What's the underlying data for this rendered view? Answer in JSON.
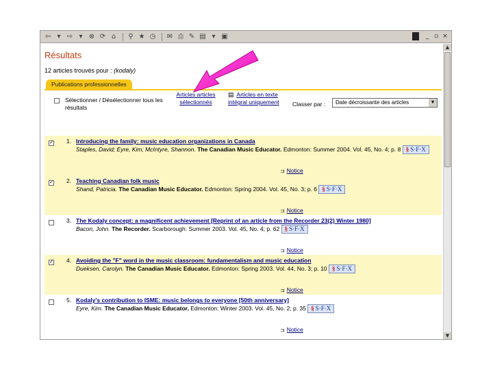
{
  "page": {
    "title": "Résultats",
    "count_text": "12 articles trouvés pour :",
    "query": "(kodaly)",
    "tab_label": "Publications professionnelles"
  },
  "controls": {
    "select_all": "Sélectionner / Désélectionner tous les résultats",
    "selected_articles": "Articles articles sélectionnés",
    "fulltext": "Articles en texte intégral uniquement",
    "sort_label": "Classer par :",
    "sort_value": "Date décroissante des articles"
  },
  "results": [
    {
      "checked": true,
      "num": "1.",
      "title": "Introducing the family: music education organizations in Canada",
      "authors": "Staples, David; Eyre, Kim; McIntyre, Shannon.",
      "journal": "The Canadian Music Educator.",
      "details": "Edmonton: Summer 2004. Vol. 45, No. 4; p. 8",
      "notice": "Notice",
      "sfx_label": "S·F·X"
    },
    {
      "checked": true,
      "num": "2.",
      "title": "Teaching Canadian folk music",
      "authors": "Shand, Patricia.",
      "journal": "The Canadian Music Educator.",
      "details": "Edmonton: Spring 2004. Vol. 45, No. 3; p. 6",
      "notice": "Notice",
      "sfx_label": "S·F·X"
    },
    {
      "checked": false,
      "num": "3.",
      "title": "The Kodaly concept: a magnificent achievement [Reprint of an article from the Recorder 23(2) Winter 1980]",
      "authors": "Bacon, John.",
      "journal": "The Recorder.",
      "details": "Scarborough: Summer 2003. Vol. 45, No. 4; p. 62",
      "notice": "Notice",
      "sfx_label": "S·F·X"
    },
    {
      "checked": true,
      "num": "4.",
      "title": "Avoiding the \"F\" word in the music classroom: fundamentalism and music education",
      "authors": "Dueksen, Carolyn.",
      "journal": "The Canadian Music Educator.",
      "details": "Edmonton: Spring 2003. Vol. 44, No. 3; p. 10",
      "notice": "Notice",
      "sfx_label": "S·F·X"
    },
    {
      "checked": false,
      "num": "5.",
      "title": "Kodaly's contribution to ISME: music belongs to everyone [50th anniversary]",
      "authors": "Eyre, Kim.",
      "journal": "The Canadian Music Educator.",
      "details": "Edmonton: Winter 2003. Vol. 45, No. 2; p. 35",
      "notice": "Notice",
      "sfx_label": "S·F·X"
    }
  ],
  "colors": {
    "title": "#c23b0f",
    "tab": "#f5c518",
    "selected_row": "#fdf7c3",
    "link": "#000080",
    "arrow": "#ff33cc"
  }
}
